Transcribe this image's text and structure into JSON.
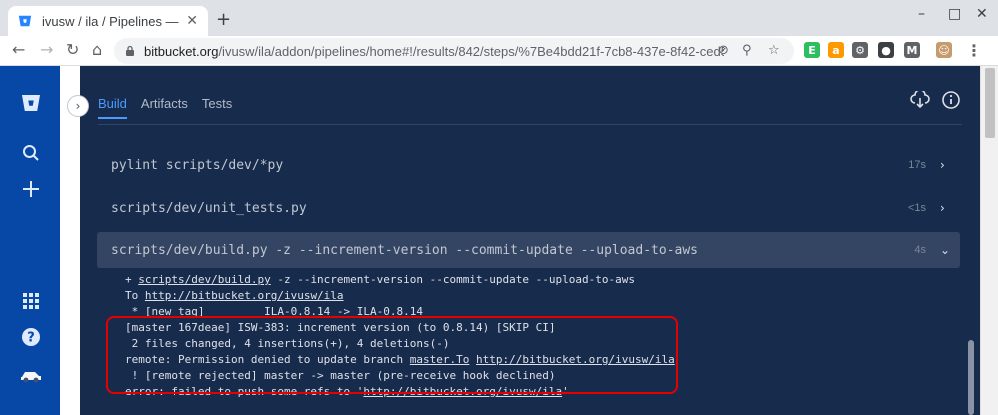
{
  "browser": {
    "tab_title": "ivusw / ila / Pipelines — B",
    "tab_close": "✕",
    "new_tab": "+",
    "window_controls": [
      "–",
      "□",
      "✕"
    ],
    "back": "←",
    "forward": "→",
    "reload": "↻",
    "home": "⌂",
    "url_host": "bitbucket.org",
    "url_path": "/ivusw/ila/addon/pipelines/home#!/results/842/steps/%7Be4bdd21f-7cb8-437e-8f42-ced56..."
  },
  "extensions": [
    {
      "name": "evernote-icon",
      "color": "#2dbe60",
      "glyph": "E"
    },
    {
      "name": "amazon-icon",
      "color": "#ff9900",
      "glyph": "a"
    },
    {
      "name": "extension-gear-icon",
      "color": "#5f6368",
      "glyph": "⚙"
    },
    {
      "name": "camera-icon",
      "color": "#3c4043",
      "glyph": "●"
    },
    {
      "name": "mendeley-icon",
      "color": "#5f6368",
      "glyph": "M"
    },
    {
      "name": "profile-avatar-icon",
      "color": "#c69c6d",
      "glyph": "☺"
    },
    {
      "name": "menu-dots-icon",
      "color": "#ffffff",
      "glyph": "⋮"
    }
  ],
  "pipeline": {
    "tabs": [
      "Build",
      "Artifacts",
      "Tests"
    ],
    "active_tab": "Build",
    "steps": [
      {
        "command": "pylint scripts/dev/*py",
        "duration": "17s",
        "chevron": "›"
      },
      {
        "command": "scripts/dev/unit_tests.py",
        "duration": "<1s",
        "chevron": "›"
      },
      {
        "command": "scripts/dev/build.py -z --increment-version --commit-update --upload-to-aws",
        "duration": "4s",
        "chevron": "⌄"
      }
    ],
    "log": [
      {
        "pre": "+ ",
        "link": "scripts/dev/build.py",
        "post": " -z --increment-version --commit-update --upload-to-aws"
      },
      {
        "pre": "To ",
        "link": "http://bitbucket.org/ivusw/ila",
        "post": ""
      },
      {
        "pre": " * [new tag]         ILA-0.8.14 -> ILA-0.8.14",
        "link": "",
        "post": ""
      },
      {
        "pre": "[master 167deae] ISW-383: increment version (to 0.8.14) [SKIP CI]",
        "link": "",
        "post": ""
      },
      {
        "pre": " 2 files changed, 4 insertions(+), 4 deletions(-)",
        "link": "",
        "post": ""
      },
      {
        "pre": "remote: Permission denied to update branch ",
        "link": "master.To",
        "post": " ",
        "link2": "http://bitbucket.org/ivusw/ila"
      },
      {
        "pre": " ! [remote rejected] master -> master (pre-receive hook declined)",
        "link": "",
        "post": ""
      },
      {
        "pre": "error: failed to push some refs to '",
        "link": "http://bitbucket.org/ivusw/ila",
        "post": "'"
      }
    ]
  },
  "colors": {
    "sidebar": "#0747a6",
    "panel": "#172b4d",
    "accent": "#4c9aff",
    "highlight": "#e60000"
  }
}
